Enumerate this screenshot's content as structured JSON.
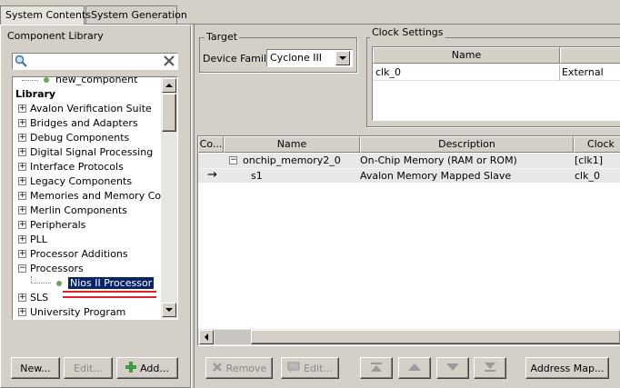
{
  "tabs": [
    "System Contents",
    "System Generation"
  ],
  "library": {
    "title": "Component Library",
    "search": {
      "value": "",
      "placeholder": ""
    },
    "items": {
      "new_component": "new_component",
      "library_header": "Library",
      "avalon": "Avalon Verification Suite",
      "bridges": "Bridges and Adapters",
      "debug": "Debug Components",
      "dsp": "Digital Signal Processing",
      "interface": "Interface Protocols",
      "legacy": "Legacy Components",
      "memories": "Memories and Memory Contro",
      "merlin": "Merlin Components",
      "peripherals": "Peripherals",
      "pll": "PLL",
      "proc_add": "Processor Additions",
      "processors": "Processors",
      "nios": "Nios II Processor",
      "sls": "SLS",
      "university": "University Program"
    },
    "buttons": {
      "new": "New...",
      "edit": "Edit...",
      "add": "Add..."
    }
  },
  "target": {
    "title": "Target",
    "device_family_label": "Device Family:",
    "device_family_value": "Cyclone III"
  },
  "clock_settings": {
    "title": "Clock Settings",
    "columns": [
      "Name",
      ""
    ],
    "rows": [
      {
        "name": "clk_0",
        "source": "External"
      }
    ]
  },
  "components_table": {
    "columns": [
      "Co...",
      "Name",
      "Description",
      "Clock"
    ],
    "rows": [
      {
        "marker": "",
        "name": "onchip_memory2_0",
        "description": "On-Chip Memory (RAM or ROM)",
        "clock": "[clk1]"
      },
      {
        "marker": "→",
        "name": "s1",
        "description": "Avalon Memory Mapped Slave",
        "clock": "clk_0"
      }
    ]
  },
  "toolbar": {
    "remove": "Remove",
    "edit": "Edit...",
    "address_map": "Address Map..."
  },
  "colors": {
    "selection": "#0a246a",
    "annotation": "#e0202a",
    "dot": "#6aa84f"
  }
}
